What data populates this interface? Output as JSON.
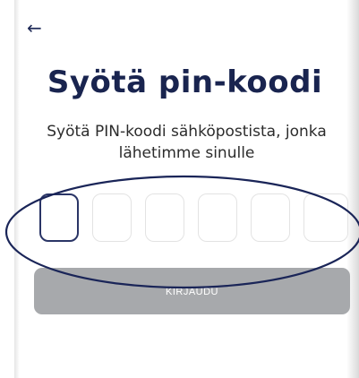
{
  "header": {
    "back_icon": "arrow-left-icon",
    "back_glyph": "←"
  },
  "main": {
    "title": "Syötä pin-koodi",
    "subtitle": "Syötä PIN-koodi sähköpostista, jonka lähetimme sinulle",
    "pin": {
      "length": 6,
      "values": [
        "",
        "",
        "",
        "",
        "",
        ""
      ],
      "active_index": 0
    },
    "login_button": {
      "label": "KIRJAUDU",
      "disabled": true
    }
  },
  "colors": {
    "title": "#19244f",
    "active_border": "#2a3566",
    "button_disabled": "#a7a9ac",
    "annotation": "#1a2558"
  }
}
